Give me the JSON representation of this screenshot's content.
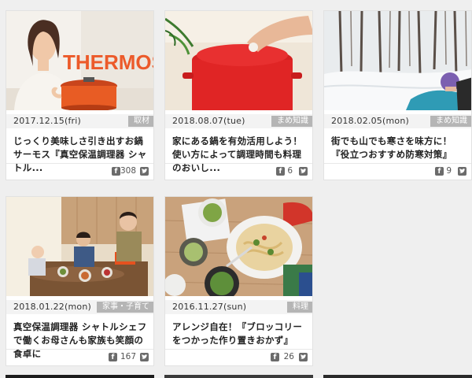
{
  "cards": [
    {
      "date": "2017.12.15(fri)",
      "category": "取材",
      "title": "じっくり美味しさ引き出すお鍋 サーモス『真空保温調理器 シャトル...",
      "fb_count": "308",
      "image": {
        "subject": "woman-with-thermos-cooker",
        "sign_text": "THERMOS"
      },
      "fb_icon": "facebook-icon",
      "tw_icon": "twitter-icon"
    },
    {
      "date": "2018.08.07(tue)",
      "category": "まめ知識",
      "title": "家にある鍋を有効活用しよう！使い方によって調理時間も料理のおいし...",
      "fb_count": "6",
      "image": {
        "subject": "red-enamel-pot"
      },
      "fb_icon": "facebook-icon",
      "tw_icon": "twitter-icon"
    },
    {
      "date": "2018.02.05(mon)",
      "category": "まめ知識",
      "title": "街でも山でも寒さを味方に！『役立つおすすめ防寒対策』",
      "fb_count": "9",
      "image": {
        "subject": "snowy-forest-child"
      },
      "fb_icon": "facebook-icon",
      "tw_icon": "twitter-icon"
    },
    {
      "date": "2018.01.22(mon)",
      "category": "家事・子育て",
      "title": "真空保温調理器 シャトルシェフで働くお母さんも家族も笑顔の食卓に",
      "fb_count": "167",
      "image": {
        "subject": "family-dining-table"
      },
      "fb_icon": "facebook-icon",
      "tw_icon": "twitter-icon"
    },
    {
      "date": "2016.11.27(sun)",
      "category": "料理",
      "title": "アレンジ自在！『ブロッコリーをつかった作り置きおかず』",
      "fb_count": "26",
      "image": {
        "subject": "pasta-and-dishes"
      },
      "fb_icon": "facebook-icon",
      "tw_icon": "twitter-icon"
    }
  ],
  "colors": {
    "background": "#efefef",
    "card": "#ffffff",
    "category_badge": "#b5b5b5",
    "icon": "#6b6b6b"
  }
}
